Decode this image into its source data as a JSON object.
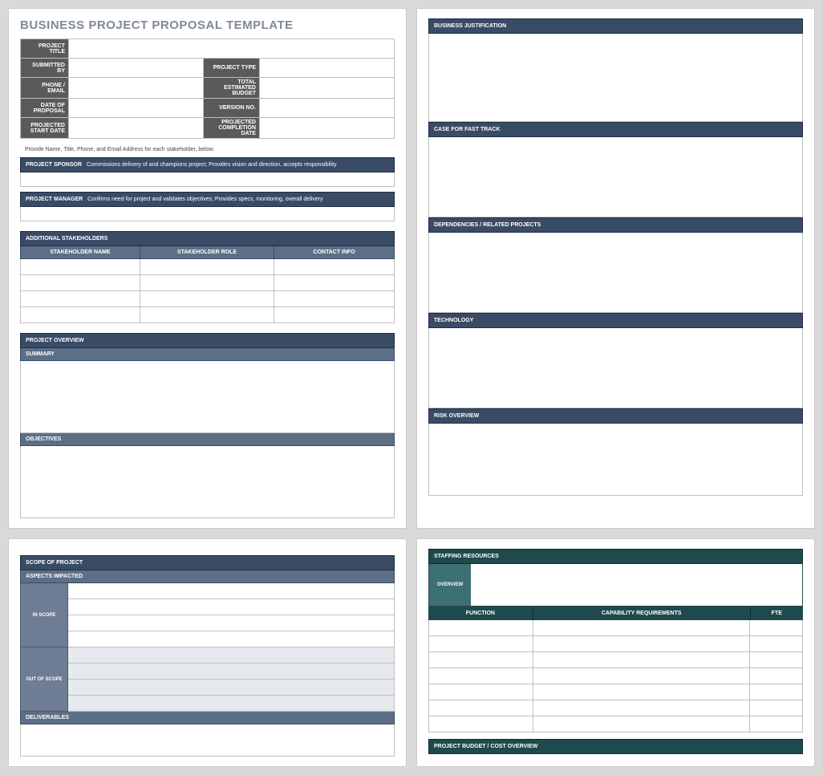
{
  "title": "BUSINESS PROJECT PROPOSAL TEMPLATE",
  "info": {
    "project_title": "PROJECT TITLE",
    "submitted_by": "SUBMITTED BY",
    "project_type": "PROJECT TYPE",
    "phone_email": "PHONE / EMAIL",
    "total_budget": "TOTAL ESTIMATED BUDGET",
    "date_of_proposal": "DATE OF PROPOSAL",
    "version_no": "VERSION NO.",
    "projected_start": "PROJECTED START DATE",
    "projected_completion": "PROJECTED COMPLETION DATE"
  },
  "hint": "Provide Name, Title, Phone, and Email Address for each stakeholder, below.",
  "sponsor": {
    "label": "PROJECT SPONSOR",
    "desc": "Commissions delivery of and champions project; Provides vision and direction, accepts responsibility"
  },
  "manager": {
    "label": "PROJECT MANAGER",
    "desc": "Confirms need for project and validates objectives; Provides specs, monitoring, overall delivery"
  },
  "stakeholders": {
    "label": "ADDITIONAL STAKEHOLDERS",
    "cols": [
      "STAKEHOLDER NAME",
      "STAKEHOLDER ROLE",
      "CONTACT INFO"
    ]
  },
  "overview": {
    "label": "PROJECT OVERVIEW",
    "summary": "SUMMARY",
    "objectives": "OBJECTIVES"
  },
  "right": {
    "justification": "BUSINESS JUSTIFICATION",
    "fast_track": "CASE FOR FAST TRACK",
    "dependencies": "DEPENDENCIES / RELATED PROJECTS",
    "technology": "TECHNOLOGY",
    "risk": "RISK OVERVIEW"
  },
  "scope": {
    "label": "SCOPE OF PROJECT",
    "aspects": "ASPECTS IMPACTED",
    "in_scope": "IN SCOPE",
    "out_scope": "OUT OF SCOPE",
    "deliverables": "DELIVERABLES"
  },
  "staffing": {
    "label": "STAFFING RESOURCES",
    "overview": "OVERVIEW",
    "cols": [
      "FUNCTION",
      "CAPABILITY REQUIREMENTS",
      "FTE"
    ],
    "budget": "PROJECT BUDGET / COST OVERVIEW"
  }
}
